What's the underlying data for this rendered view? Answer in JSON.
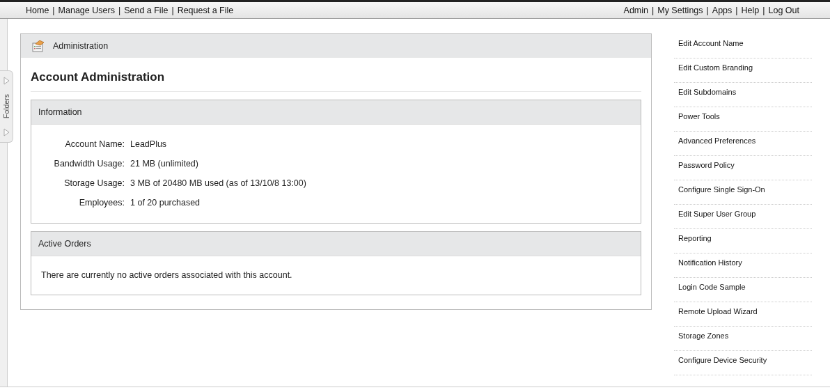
{
  "top_nav": {
    "left_links": [
      "Home",
      "Manage Users",
      "Send a File",
      "Request a File"
    ],
    "right_links": [
      "Admin",
      "My Settings",
      "Apps",
      "Help",
      "Log Out"
    ],
    "separator": "|"
  },
  "folders_tab": {
    "label": "Folders"
  },
  "panel": {
    "header": "Administration",
    "title": "Account Administration",
    "sections": [
      {
        "kind": "fields",
        "title": "Information",
        "fields": [
          {
            "label": "Account Name:",
            "value": "LeadPlus"
          },
          {
            "label": "Bandwidth Usage:",
            "value": "21 MB (unlimited)"
          },
          {
            "label": "Storage Usage:",
            "value": "3 MB of 20480 MB used (as of 13/10/8 13:00)"
          },
          {
            "label": "Employees:",
            "value": "1 of 20 purchased"
          }
        ]
      },
      {
        "kind": "message",
        "title": "Active Orders",
        "message": "There are currently no active orders associated with this account."
      }
    ]
  },
  "sidebar": {
    "items": [
      "Edit Account Name",
      "Edit Custom Branding",
      "Edit Subdomains",
      "Power Tools",
      "Advanced Preferences",
      "Password Policy",
      "Configure Single Sign-On",
      "Edit Super User Group",
      "Reporting",
      "Notification History",
      "Login Code Sample",
      "Remote Upload Wizard",
      "Storage Zones",
      "Configure Device Security"
    ]
  }
}
